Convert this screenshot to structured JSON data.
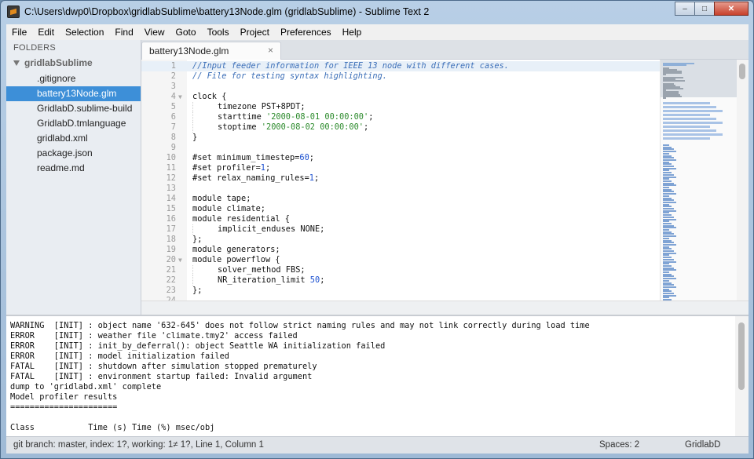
{
  "window": {
    "title": "C:\\Users\\dwp0\\Dropbox\\gridlabSublime\\battery13Node.glm (gridlabSublime) - Sublime Text 2",
    "minimize": "–",
    "maximize": "□",
    "close": "✕"
  },
  "menu": [
    "File",
    "Edit",
    "Selection",
    "Find",
    "View",
    "Goto",
    "Tools",
    "Project",
    "Preferences",
    "Help"
  ],
  "sidebar": {
    "header": "FOLDERS",
    "folder": "gridlabSublime",
    "files": [
      ".gitignore",
      "battery13Node.glm",
      "GridlabD.sublime-build",
      "GridlabD.tmlanguage",
      "gridlabd.xml",
      "package.json",
      "readme.md"
    ],
    "active_index": 1
  },
  "tab": {
    "label": "battery13Node.glm",
    "close": "×"
  },
  "editor": {
    "current_line": 1,
    "lines": [
      {
        "n": "1",
        "fold": "",
        "indent": 0,
        "segs": [
          [
            "cm",
            "//Input feeder information for IEEE 13 node with different cases."
          ]
        ]
      },
      {
        "n": "2",
        "fold": "",
        "indent": 0,
        "segs": [
          [
            "cm",
            "// File for testing syntax highlighting."
          ]
        ]
      },
      {
        "n": "3",
        "fold": "",
        "indent": 0,
        "segs": []
      },
      {
        "n": "4",
        "fold": "▼",
        "indent": 0,
        "segs": [
          [
            "",
            "clock {"
          ]
        ]
      },
      {
        "n": "5",
        "fold": "",
        "indent": 1,
        "segs": [
          [
            "",
            "timezone PST+8PDT;"
          ]
        ]
      },
      {
        "n": "6",
        "fold": "",
        "indent": 1,
        "segs": [
          [
            "",
            "starttime "
          ],
          [
            "st",
            "'2000-08-01 00:00:00'"
          ],
          [
            "",
            ";"
          ]
        ]
      },
      {
        "n": "7",
        "fold": "",
        "indent": 1,
        "segs": [
          [
            "",
            "stoptime "
          ],
          [
            "st",
            "'2000-08-02 00:00:00'"
          ],
          [
            "",
            ";"
          ]
        ]
      },
      {
        "n": "8",
        "fold": "",
        "indent": 0,
        "segs": [
          [
            "",
            "}"
          ]
        ]
      },
      {
        "n": "9",
        "fold": "",
        "indent": 0,
        "segs": []
      },
      {
        "n": "10",
        "fold": "",
        "indent": 0,
        "segs": [
          [
            "",
            "#set minimum_timestep="
          ],
          [
            "nu",
            "60"
          ],
          [
            "",
            ";"
          ]
        ]
      },
      {
        "n": "11",
        "fold": "",
        "indent": 0,
        "segs": [
          [
            "",
            "#set profiler="
          ],
          [
            "nu",
            "1"
          ],
          [
            "",
            ";"
          ]
        ]
      },
      {
        "n": "12",
        "fold": "",
        "indent": 0,
        "segs": [
          [
            "",
            "#set relax_naming_rules="
          ],
          [
            "nu",
            "1"
          ],
          [
            "",
            ";"
          ]
        ]
      },
      {
        "n": "13",
        "fold": "",
        "indent": 0,
        "segs": []
      },
      {
        "n": "14",
        "fold": "",
        "indent": 0,
        "segs": [
          [
            "",
            "module tape;"
          ]
        ]
      },
      {
        "n": "15",
        "fold": "",
        "indent": 0,
        "segs": [
          [
            "",
            "module climate;"
          ]
        ]
      },
      {
        "n": "16",
        "fold": "",
        "indent": 0,
        "segs": [
          [
            "",
            "module residential {"
          ]
        ]
      },
      {
        "n": "17",
        "fold": "",
        "indent": 1,
        "segs": [
          [
            "",
            "implicit_enduses NONE;"
          ]
        ]
      },
      {
        "n": "18",
        "fold": "",
        "indent": 0,
        "segs": [
          [
            "",
            "};"
          ]
        ]
      },
      {
        "n": "19",
        "fold": "",
        "indent": 0,
        "segs": [
          [
            "",
            "module generators;"
          ]
        ]
      },
      {
        "n": "20",
        "fold": "▼",
        "indent": 0,
        "segs": [
          [
            "",
            "module powerflow {"
          ]
        ]
      },
      {
        "n": "21",
        "fold": "",
        "indent": 1,
        "segs": [
          [
            "",
            "solver_method FBS;"
          ]
        ]
      },
      {
        "n": "22",
        "fold": "",
        "indent": 1,
        "segs": [
          [
            "",
            "NR_iteration_limit "
          ],
          [
            "nu",
            "50"
          ],
          [
            "",
            ";"
          ]
        ]
      },
      {
        "n": "23",
        "fold": "",
        "indent": 0,
        "segs": [
          [
            "",
            "};"
          ]
        ]
      },
      {
        "n": "24",
        "fold": "",
        "indent": 0,
        "segs": []
      }
    ]
  },
  "console": {
    "lines": [
      "WARNING  [INIT] : object name '632-645' does not follow strict naming rules and may not link correctly during load time",
      "ERROR    [INIT] : weather file 'climate.tmy2' access failed",
      "ERROR    [INIT] : init_by_deferral(): object Seattle WA initialization failed",
      "ERROR    [INIT] : model initialization failed",
      "FATAL    [INIT] : shutdown after simulation stopped prematurely",
      "FATAL    [INIT] : environment startup failed: Invalid argument",
      "dump to 'gridlabd.xml' complete",
      "Model profiler results",
      "======================",
      "",
      "Class           Time (s) Time (%) msec/obj"
    ]
  },
  "status": {
    "left": "git branch: master, index: 1?, working: 1≠ 1?, Line 1, Column 1",
    "spaces": "Spaces: 2",
    "syntax": "GridlabD"
  },
  "colors": {
    "selection": "#3d8fd8",
    "comment": "#3c6fb8",
    "string": "#2b8a2b",
    "number": "#1a4fd0"
  }
}
